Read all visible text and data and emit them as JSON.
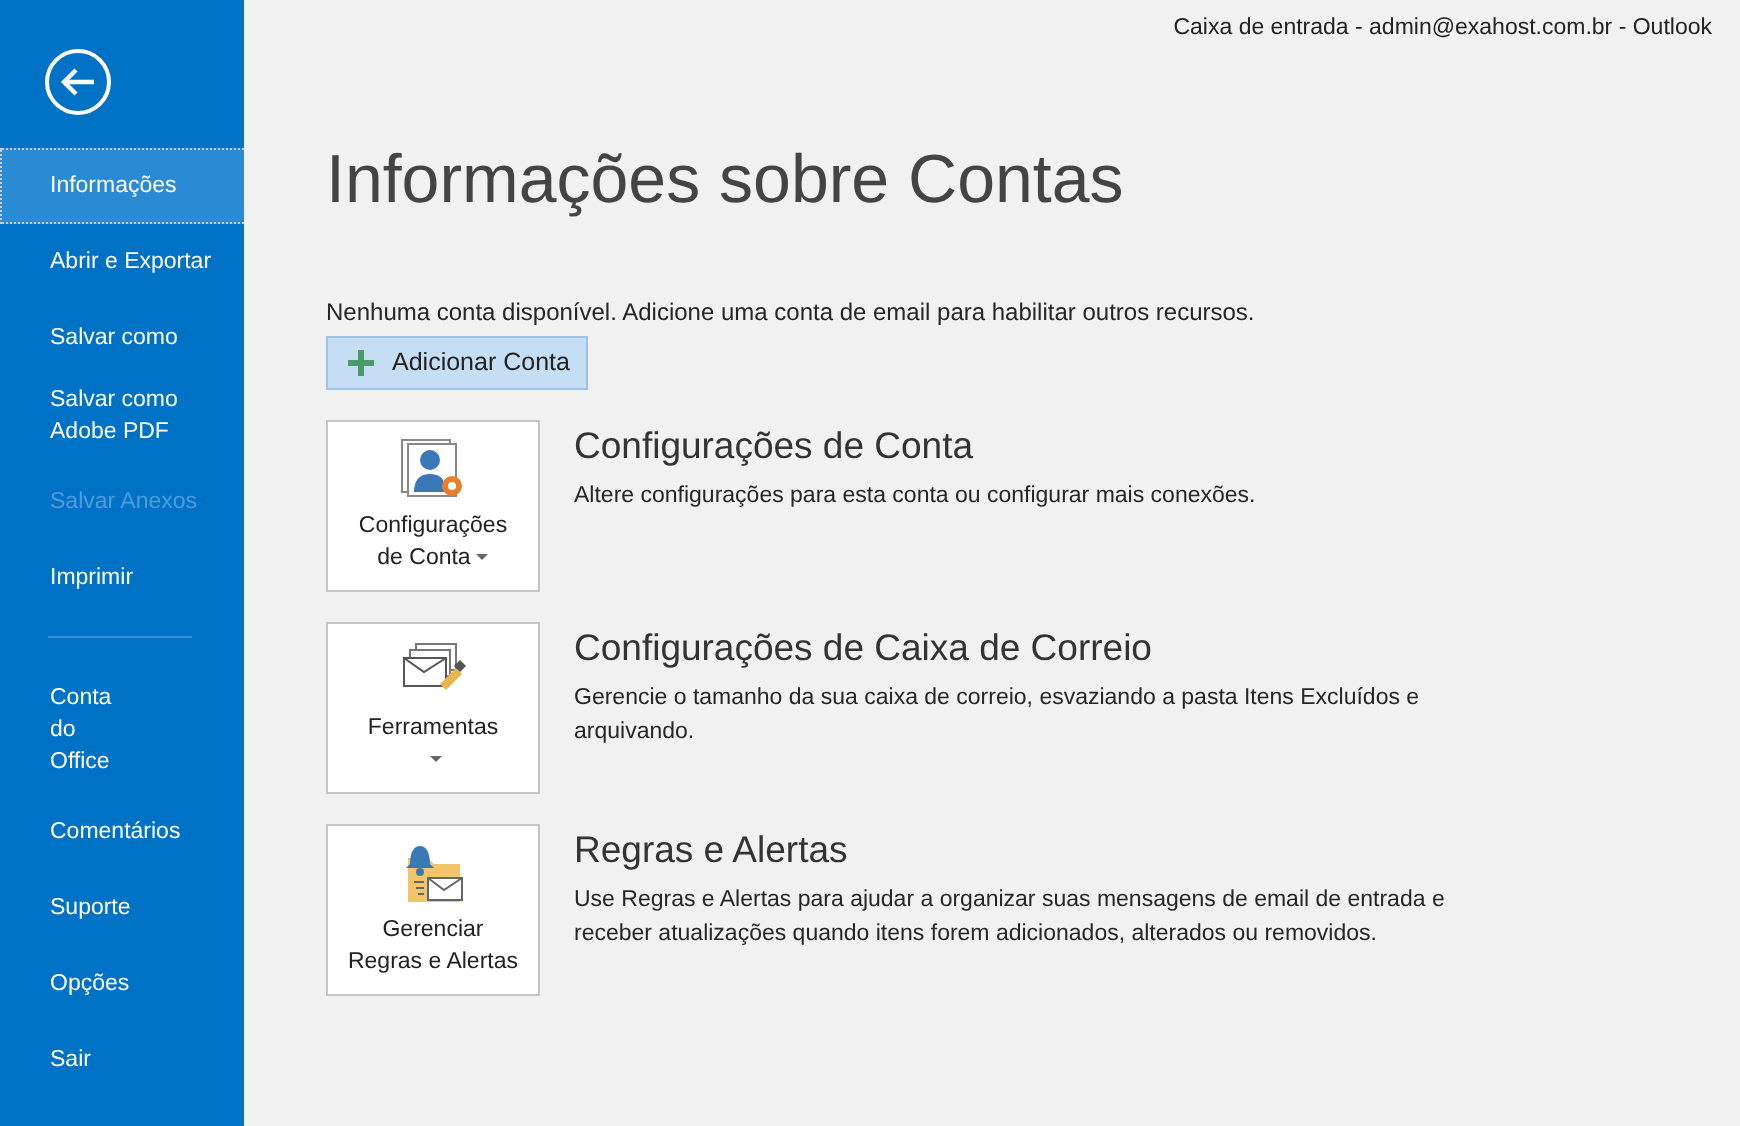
{
  "window": {
    "title": "Caixa de entrada - admin@exahost.com.br - Outlook"
  },
  "sidebar": {
    "items": [
      {
        "label": "Informações",
        "selected": true,
        "disabled": false
      },
      {
        "label": "Abrir e Exportar",
        "selected": false,
        "disabled": false
      },
      {
        "label": "Salvar como",
        "selected": false,
        "disabled": false
      },
      {
        "label": "Salvar como\nAdobe PDF",
        "selected": false,
        "disabled": false
      },
      {
        "label": "Salvar Anexos",
        "selected": false,
        "disabled": true
      },
      {
        "label": "Imprimir",
        "selected": false,
        "disabled": false
      }
    ],
    "lower_items": [
      {
        "label": "Conta\ndo\nOffice",
        "selected": false,
        "disabled": false
      },
      {
        "label": "Comentários",
        "selected": false,
        "disabled": false
      },
      {
        "label": "Suporte",
        "selected": false,
        "disabled": false
      },
      {
        "label": "Opções",
        "selected": false,
        "disabled": false
      },
      {
        "label": "Sair",
        "selected": false,
        "disabled": false
      }
    ]
  },
  "page": {
    "title": "Informações sobre Contas",
    "notice": "Nenhuma conta disponível. Adicione uma conta de email para habilitar outros recursos.",
    "add_button": "Adicionar Conta"
  },
  "sections": [
    {
      "kind": "account",
      "button": "Configurações\nde Conta",
      "dropdown": true,
      "title": "Configurações de Conta",
      "description": "Altere configurações para esta conta ou configurar mais conexões."
    },
    {
      "kind": "tools",
      "button": "Ferramentas",
      "dropdown": true,
      "title": "Configurações de Caixa de Correio",
      "description": "Gerencie o tamanho da sua caixa de correio, esvaziando a pasta Itens Excluídos e arquivando."
    },
    {
      "kind": "rules",
      "button": "Gerenciar\nRegras e Alertas",
      "dropdown": false,
      "title": "Regras e Alertas",
      "description": "Use Regras e Alertas para ajudar a organizar suas mensagens de email de entrada e receber atualizações quando itens forem adicionados, alterados ou removidos."
    }
  ]
}
